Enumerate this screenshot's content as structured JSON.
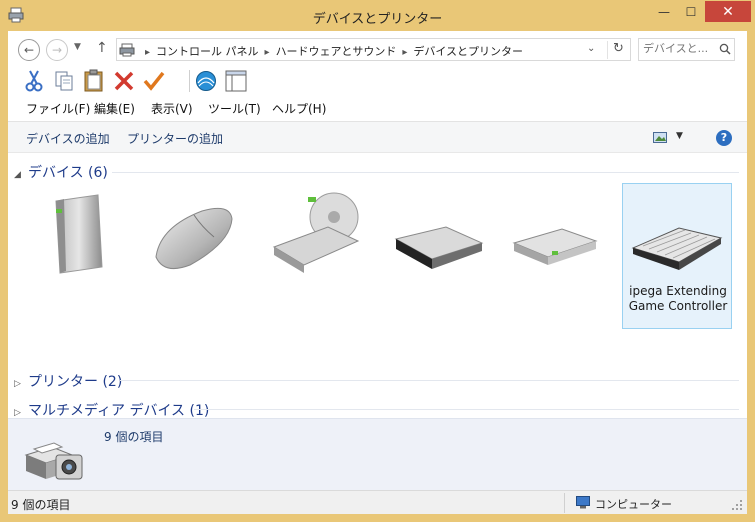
{
  "window": {
    "title": "デバイスとプリンター",
    "controls": {
      "minimize": "—",
      "maximize": "☐",
      "close": "✕"
    }
  },
  "address": {
    "breadcrumb": [
      "コントロール パネル",
      "ハードウェアとサウンド",
      "デバイスとプリンター"
    ],
    "search_placeholder": "デバイスと..."
  },
  "toolbar_icons": [
    "cut-icon",
    "copy-icon",
    "paste-icon",
    "delete-icon",
    "check-icon",
    "shell-icon",
    "properties-icon"
  ],
  "menu": {
    "file": "ファイル(F)",
    "edit": "編集(E)",
    "view": "表示(V)",
    "tools": "ツール(T)",
    "help": "ヘルプ(H)"
  },
  "commands": {
    "add_device": "デバイスの追加",
    "add_printer": "プリンターの追加"
  },
  "groups": {
    "devices": {
      "label": "デバイス (6)"
    },
    "printers": {
      "label": "プリンター (2)"
    },
    "multimedia": {
      "label": "マルチメディア デバイス (1)"
    }
  },
  "devices": [
    {
      "label": ""
    },
    {
      "label": ""
    },
    {
      "label": ""
    },
    {
      "label": ""
    },
    {
      "label": ""
    },
    {
      "label": "ipega Extending Game Controller"
    }
  ],
  "details": {
    "text": "9 個の項目"
  },
  "status": {
    "left": "9 個の項目",
    "right": "コンピューター"
  },
  "colors": {
    "frame": "#e9c777",
    "close": "#c7463b",
    "group_header": "#1e3b8a",
    "selected_bg": "#e6f2fb",
    "selected_border": "#99d1f1"
  }
}
